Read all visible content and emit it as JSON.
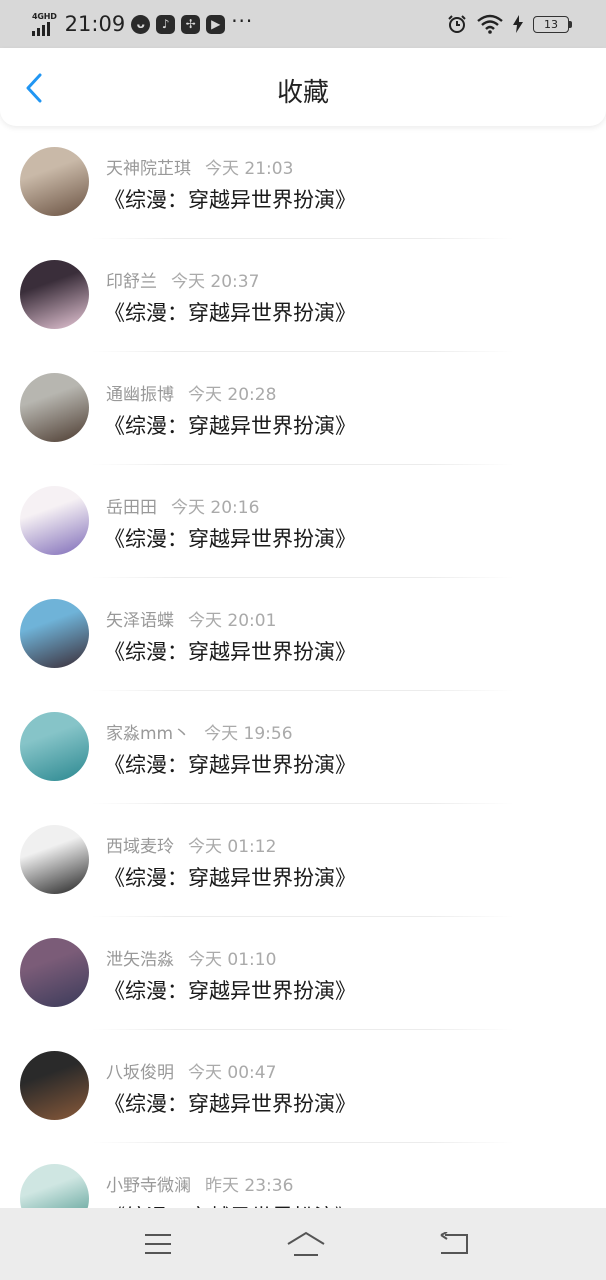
{
  "status_bar": {
    "network": "4GHD",
    "time": "21:09",
    "battery": "13"
  },
  "header": {
    "title": "收藏"
  },
  "items": [
    {
      "user": "天神院芷琪",
      "time": "今天 21:03",
      "book": "《综漫：穿越异世界扮演》",
      "avatar_colors": [
        "#c9b9a8",
        "#6a5242"
      ]
    },
    {
      "user": "印舒兰",
      "time": "今天 20:37",
      "book": "《综漫：穿越异世界扮演》",
      "avatar_colors": [
        "#3a2e3a",
        "#e8c8d8"
      ]
    },
    {
      "user": "通幽振博",
      "time": "今天 20:28",
      "book": "《综漫：穿越异世界扮演》",
      "avatar_colors": [
        "#b7b6b0",
        "#4c3b30"
      ]
    },
    {
      "user": "岳田田",
      "time": "今天 20:16",
      "book": "《综漫：穿越异世界扮演》",
      "avatar_colors": [
        "#f6f1f4",
        "#7e6bb8"
      ]
    },
    {
      "user": "矢泽语蝶",
      "time": "今天 20:01",
      "book": "《综漫：穿越异世界扮演》",
      "avatar_colors": [
        "#6fb3d8",
        "#3a2b35"
      ]
    },
    {
      "user": "家淼mm丶",
      "time": "今天 19:56",
      "book": "《综漫：穿越异世界扮演》",
      "avatar_colors": [
        "#86c4c8",
        "#2b8890"
      ]
    },
    {
      "user": "西域麦玲",
      "time": "今天 01:12",
      "book": "《综漫：穿越异世界扮演》",
      "avatar_colors": [
        "#f0f0f0",
        "#222222"
      ]
    },
    {
      "user": "泄矢浩淼",
      "time": "今天 01:10",
      "book": "《综漫：穿越异世界扮演》",
      "avatar_colors": [
        "#7b5c78",
        "#3b3b5a"
      ]
    },
    {
      "user": "八坂俊明",
      "time": "今天 00:47",
      "book": "《综漫：穿越异世界扮演》",
      "avatar_colors": [
        "#2a2a2a",
        "#8a5a3a"
      ]
    },
    {
      "user": "小野寺微澜",
      "time": "昨天 23:36",
      "book": "《综漫：穿越异世界扮演》",
      "avatar_colors": [
        "#cfe6e2",
        "#3e8e84"
      ]
    }
  ],
  "colors": {
    "accent": "#2196f3",
    "status_bar_bg": "#d8d8d8",
    "nav_bg": "#ececec"
  },
  "nav": {
    "icons": [
      "menu-icon",
      "home-icon",
      "back-icon"
    ]
  }
}
